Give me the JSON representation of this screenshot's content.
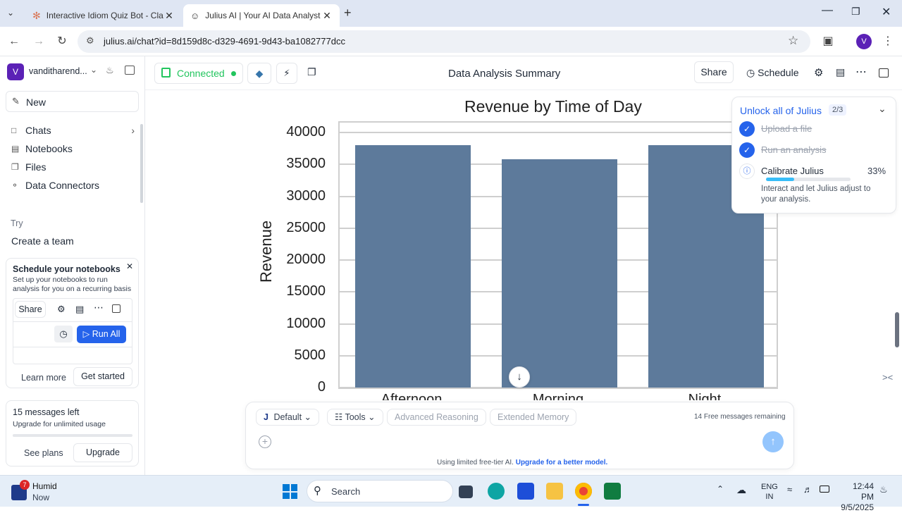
{
  "browser": {
    "tabs": [
      {
        "title": "Interactive Idiom Quiz Bot - Cla",
        "active": false
      },
      {
        "title": "Julius AI | Your AI Data Analyst",
        "active": true
      }
    ],
    "url": "julius.ai/chat?id=8d159d8c-d329-4691-9d43-ba1082777dcc",
    "profile_initial": "V"
  },
  "sidebar": {
    "user": {
      "initial": "V",
      "name": "vanditharend..."
    },
    "new_label": "New",
    "nav": [
      {
        "label": "Chats",
        "icon": "chat-icon"
      },
      {
        "label": "Notebooks",
        "icon": "notebook-icon"
      },
      {
        "label": "Files",
        "icon": "file-icon"
      },
      {
        "label": "Data Connectors",
        "icon": "connector-icon"
      }
    ],
    "try_label": "Try",
    "create_team": "Create a team",
    "schedule_card": {
      "title": "Schedule your notebooks",
      "desc": "Set up your notebooks to run analysis for you on a recurring basis",
      "share": "Share",
      "run_all": "Run All",
      "learn_more": "Learn more",
      "get_started": "Get started"
    },
    "messages_card": {
      "title": "15 messages left",
      "desc": "Upgrade for unlimited usage",
      "see_plans": "See plans",
      "upgrade": "Upgrade"
    }
  },
  "topbar": {
    "connected": "Connected",
    "title": "Data Analysis Summary",
    "share": "Share",
    "schedule": "Schedule"
  },
  "chart_data": {
    "type": "bar",
    "title": "Revenue by Time of Day",
    "ylabel": "Revenue",
    "xlabel": "",
    "categories": [
      "Afternoon",
      "Morning",
      "Night"
    ],
    "values": [
      38000,
      35800,
      38000
    ],
    "ylim": [
      0,
      40000
    ],
    "yticks": [
      "40000",
      "35000",
      "30000",
      "25000",
      "20000",
      "15000",
      "10000",
      "5000",
      "0"
    ],
    "grid": true,
    "bar_color": "#5d7a9b"
  },
  "unlock_panel": {
    "title": "Unlock all of Julius",
    "progress_count": "2/3",
    "steps": [
      {
        "label": "Upload a file",
        "done": true
      },
      {
        "label": "Run an analysis",
        "done": true
      },
      {
        "label": "Calibrate Julius",
        "done": false,
        "percent": "33%",
        "progress": 0.33,
        "desc": "Interact and let Julius adjust to your analysis."
      }
    ]
  },
  "composer": {
    "model": "Default",
    "model_initial": "J",
    "tools": "Tools",
    "advanced_reasoning": "Advanced Reasoning",
    "extended_memory": "Extended Memory",
    "free_count": "14",
    "free_text": "Free messages remaining",
    "footer": "Using limited free-tier AI.",
    "footer_link": "Upgrade for a better model."
  },
  "taskbar": {
    "weather_badge": "7",
    "weather_title": "Humid",
    "weather_sub": "Now",
    "search": "Search",
    "lang": "ENG",
    "region": "IN",
    "time": "12:44 PM",
    "date": "9/5/2025"
  }
}
